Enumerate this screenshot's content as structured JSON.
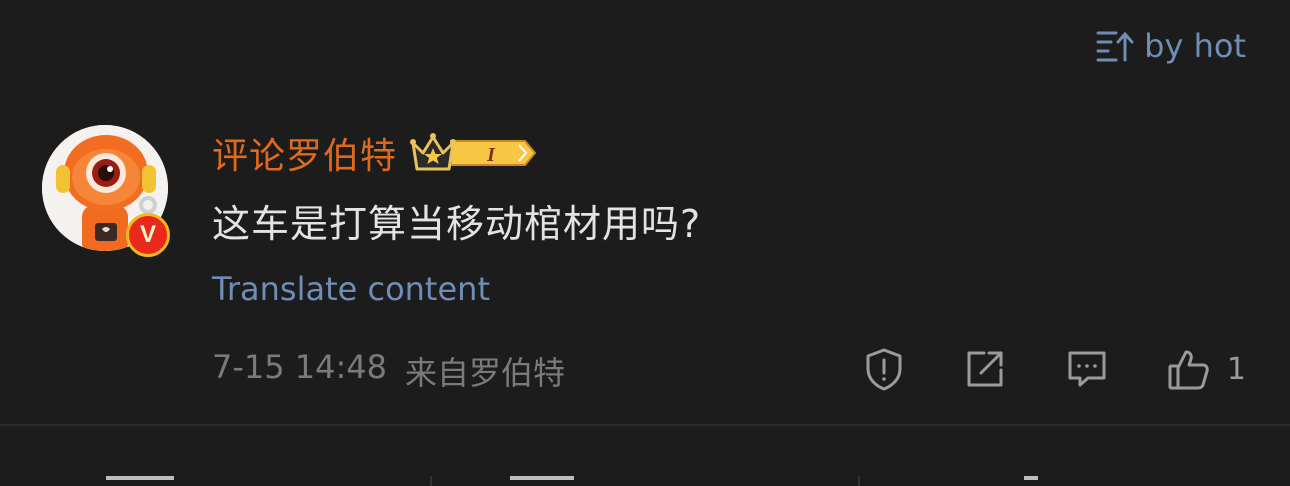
{
  "sort": {
    "label": "by hot",
    "icon": "sort-up-icon"
  },
  "comment": {
    "username": "评论罗伯特",
    "level_badge_label": "I",
    "verified_badge_label": "V",
    "text": "这车是打算当移动棺材用吗?",
    "translate_label": "Translate content",
    "date": "7-15 14:48",
    "source": "来自罗伯特",
    "like_count": "1"
  },
  "colors": {
    "background": "#1c1c1c",
    "username": "#e06a1c",
    "link": "#6f8db7",
    "text": "#e3e3e3",
    "meta": "#7a7a7a",
    "icon": "#9b9b9b"
  },
  "icons": [
    "report-icon",
    "share-icon",
    "reply-icon",
    "like-icon"
  ]
}
